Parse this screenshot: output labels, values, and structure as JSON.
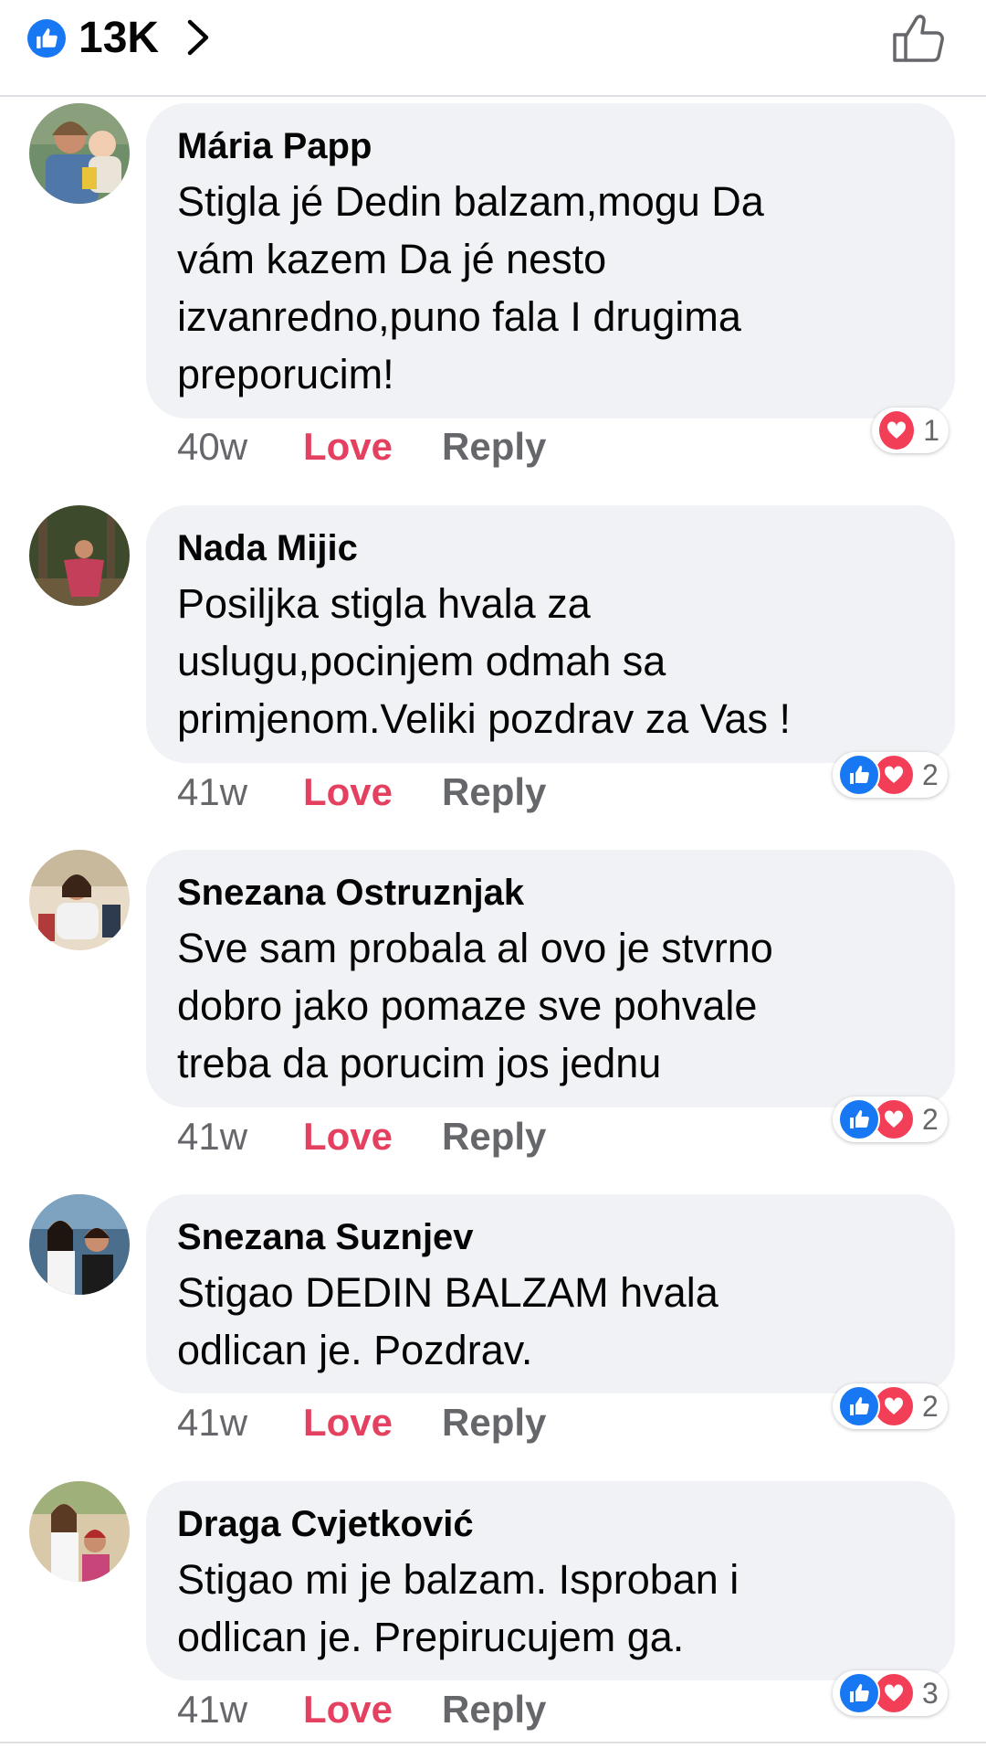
{
  "header": {
    "like_count": "13K",
    "like_icon": "like-icon",
    "chevron_icon": "chevron-right-icon",
    "thumb_icon": "thumbs-up-outline-icon"
  },
  "colors": {
    "like_blue": "#1877f2",
    "love_red": "#f33e58",
    "love_text": "#e4405f",
    "bubble_bg": "#f0f2f5",
    "meta_gray": "#65676b"
  },
  "comments": [
    {
      "author": "Mária Papp",
      "text": "Stigla jé Dedin balzam,mogu Da\nvám kazem Da jé nesto\nizvanredno,puno fala I drugima\npreporucim!",
      "time": "40w",
      "love_label": "Love",
      "reply_label": "Reply",
      "reactions": [
        "love"
      ],
      "reaction_count": "1"
    },
    {
      "author": "Nada Mijic",
      "text": "Posiljka stigla hvala za\nuslugu,pocinjem odmah sa\nprimjenom.Veliki pozdrav za Vas !",
      "time": "41w",
      "love_label": "Love",
      "reply_label": "Reply",
      "reactions": [
        "like",
        "love"
      ],
      "reaction_count": "2"
    },
    {
      "author": "Snezana Ostruznjak",
      "text": "Sve sam probala al ovo je stvrno\ndobro jako pomaze sve pohvale\ntreba da porucim jos jednu",
      "time": "41w",
      "love_label": "Love",
      "reply_label": "Reply",
      "reactions": [
        "like",
        "love"
      ],
      "reaction_count": "2"
    },
    {
      "author": "Snezana Suznjev",
      "text": "Stigao DEDIN BALZAM hvala\nodlican je. Pozdrav.",
      "time": "41w",
      "love_label": "Love",
      "reply_label": "Reply",
      "reactions": [
        "like",
        "love"
      ],
      "reaction_count": "2"
    },
    {
      "author": "Draga Cvjetković",
      "text": "Stigao mi je balzam. Isproban i\nodlican je. Prepirucujem ga.",
      "time": "41w",
      "love_label": "Love",
      "reply_label": "Reply",
      "reactions": [
        "like",
        "love"
      ],
      "reaction_count": "3"
    }
  ]
}
